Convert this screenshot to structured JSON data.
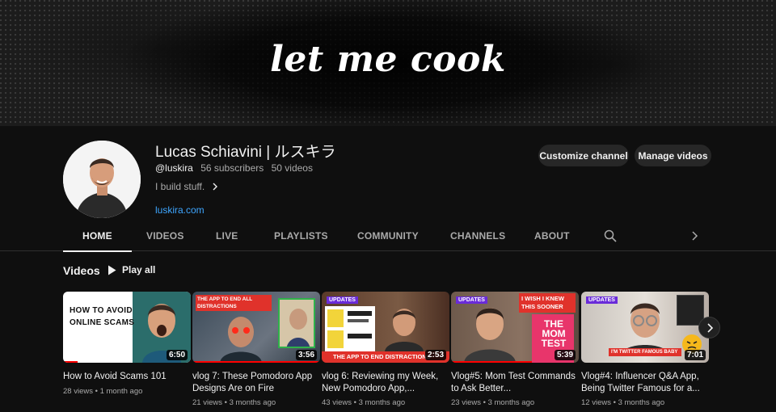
{
  "banner": {
    "text": "let me cook"
  },
  "channel": {
    "name": "Lucas Schiavini | ルスキラ",
    "handle": "@luskira",
    "subscribers": "56 subscribers",
    "videos_count": "50 videos",
    "description": "I build stuff.",
    "link": "luskira.com"
  },
  "actions": {
    "customize": "Customize channel",
    "manage": "Manage videos"
  },
  "tabs": [
    "HOME",
    "VIDEOS",
    "LIVE",
    "PLAYLISTS",
    "COMMUNITY",
    "CHANNELS",
    "ABOUT"
  ],
  "active_tab": "HOME",
  "section": {
    "title": "Videos",
    "play_all": "Play all"
  },
  "videos": [
    {
      "title": "How to Avoid Scams 101",
      "views": "28 views",
      "age": "1 month ago",
      "duration": "6:50",
      "thumb_text": "HOW TO AVOID ONLINE SCAMS"
    },
    {
      "title": "vlog 7: These Pomodoro App Designs Are on Fire",
      "views": "21 views",
      "age": "3 months ago",
      "duration": "3:56",
      "thumb_text": "THE APP TO END ALL DISTRACTIONS"
    },
    {
      "title": "vlog 6: Reviewing my Week, New Pomodoro App,...",
      "views": "43 views",
      "age": "3 months ago",
      "duration": "2:53",
      "thumb_text": "THE APP TO END DISTRACTIONS",
      "badge": "UPDATES"
    },
    {
      "title": "Vlog#5: Mom Test Commands to Ask Better...",
      "views": "23 views",
      "age": "3 months ago",
      "duration": "5:39",
      "thumb_text": "I WISH I KNEW THIS SOONER",
      "badge": "UPDATES",
      "book_title": "THE MOM TEST"
    },
    {
      "title": "Vlog#4: Influencer Q&A App, Being Twitter Famous for a...",
      "views": "12 views",
      "age": "3 months ago",
      "duration": "7:01",
      "thumb_text": "I'M TWITTER FAMOUS BABY",
      "badge": "UPDATES"
    }
  ],
  "colors": {
    "link": "#3ea6ff",
    "background": "#0f0f0f",
    "badge": "#6a2bd9",
    "accent_red": "#e0322b"
  },
  "icons": [
    "search-icon",
    "chevron-right-icon",
    "play-icon",
    "user-avatar"
  ]
}
